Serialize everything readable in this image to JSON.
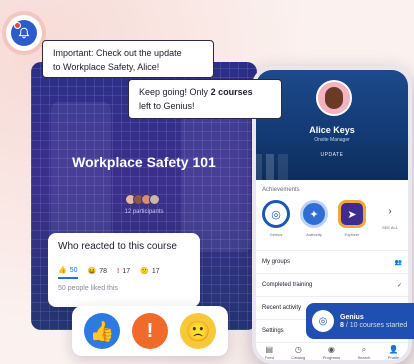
{
  "notification": {
    "icon": "bell-icon",
    "badge_color": "#e24a3b"
  },
  "bubbles": {
    "top": {
      "line1": "Important: Check out the update",
      "line2": "to Workplace Safety, Alice!"
    },
    "bottom": {
      "line1_prefix": "Keep going! Only ",
      "line1_strong": "2 courses",
      "line2": "left to Genius!"
    }
  },
  "course": {
    "title": "Workplace Safety 101",
    "participants_label": "12 participants",
    "participant_colors": [
      "#e9b9a3",
      "#8c5a44",
      "#d98c6e",
      "#c9b7a8"
    ]
  },
  "reactions": {
    "title": "Who reacted to this course",
    "items": [
      {
        "icon": "thumbs-up-icon",
        "glyph": "👍",
        "count": "50",
        "active": true
      },
      {
        "icon": "laugh-icon",
        "glyph": "😆",
        "count": "78",
        "active": false
      },
      {
        "icon": "exclamation-icon",
        "glyph": "!",
        "count": "17",
        "active": false
      },
      {
        "icon": "hmm-icon",
        "glyph": "🙁",
        "count": "17",
        "active": false
      }
    ],
    "footer": "50 people liked this"
  },
  "reaction_bar": [
    {
      "icon": "like-reaction-icon",
      "glyph": "👍"
    },
    {
      "icon": "alert-reaction-icon",
      "glyph": "!"
    },
    {
      "icon": "hmm-reaction-icon",
      "glyph": "🙁"
    }
  ],
  "profile": {
    "name": "Alice Keys",
    "role": "Onsite Manager",
    "update": "UPDATE",
    "achievements_label": "Achievements",
    "badges": [
      {
        "label": "Genius",
        "icon": "genius-badge-icon",
        "glyph": "◎"
      },
      {
        "label": "Authority",
        "icon": "authority-badge-icon",
        "glyph": "✦"
      },
      {
        "label": "Explorer",
        "icon": "explorer-badge-icon",
        "glyph": "➤"
      }
    ],
    "see_all": "SEE ALL",
    "menu": [
      {
        "label": "My groups",
        "icon": "groups-icon",
        "glyph": "👥"
      },
      {
        "label": "Completed training",
        "icon": "check-icon",
        "glyph": "✓"
      },
      {
        "label": "Recent activity",
        "icon": "activity-icon",
        "glyph": "›"
      },
      {
        "label": "Settings",
        "icon": "settings-icon",
        "glyph": ""
      }
    ],
    "tabs": [
      {
        "label": "Feed",
        "icon": "feed-icon",
        "glyph": "▤",
        "active": false
      },
      {
        "label": "Catalog",
        "icon": "catalog-icon",
        "glyph": "◷",
        "active": false
      },
      {
        "label": "Programs",
        "icon": "programs-icon",
        "glyph": "◉",
        "active": false
      },
      {
        "label": "Search",
        "icon": "search-icon",
        "glyph": "⌕",
        "active": false
      },
      {
        "label": "Profile",
        "icon": "profile-icon",
        "glyph": "👤",
        "active": true
      }
    ]
  },
  "genius_toast": {
    "title": "Genius",
    "completed": "8",
    "rest": " / 10 courses started"
  },
  "colors": {
    "accent": "#1c57b5",
    "course_bg": "#3d2f8c",
    "like": "#2d7ae0",
    "alert": "#f06a2a",
    "hmm": "#f7c83a"
  }
}
